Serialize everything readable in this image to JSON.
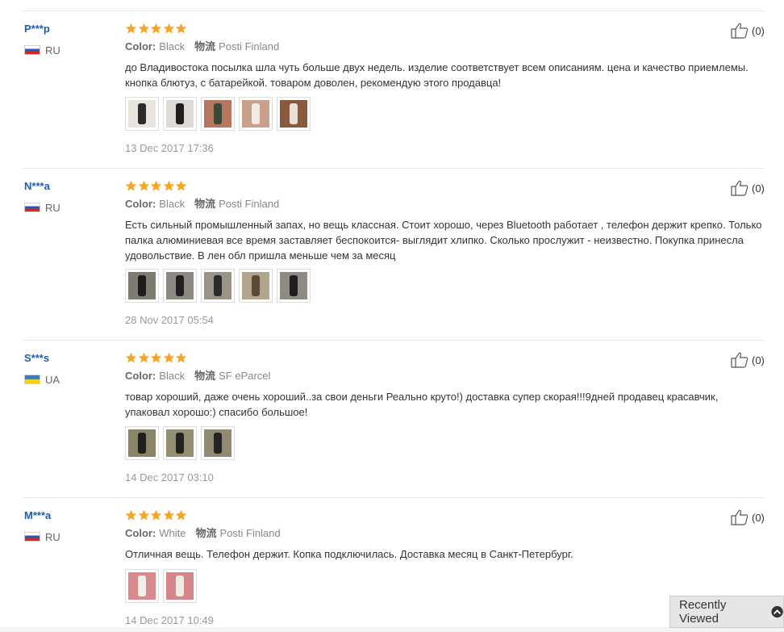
{
  "labels": {
    "color_label": "Color:",
    "shipping_label": "物流"
  },
  "reviews": [
    {
      "user": "P***p",
      "country": "RU",
      "rating": 5,
      "color": "Black",
      "shipping": "Posti Finland",
      "text": "до Владивостока посылка шла чуть больше двух недель. изделие соответствует всем описаниям. цена и качество приемлемы. кнопка блютуз, с батарейкой. товаром доволен, рекомендую этого продавца!",
      "photos": [
        {
          "bg": "#e9e4de",
          "obj": "#2a2a2a"
        },
        {
          "bg": "#dedbd6",
          "obj": "#1e1e1e"
        },
        {
          "bg": "#b7765e",
          "obj": "#3a4a3a"
        },
        {
          "bg": "#c9a08a",
          "obj": "#f1ebe6"
        },
        {
          "bg": "#8a5a3e",
          "obj": "#e8e0d8"
        }
      ],
      "date": "13 Dec 2017 17:36",
      "helpful": "(0)"
    },
    {
      "user": "N***a",
      "country": "RU",
      "rating": 5,
      "color": "Black",
      "shipping": "Posti Finland",
      "text": "Есть сильный промышленный запах, но вещь классная. Стоит хорошо, через Bluetooth работает , телефон держит крепко. Только палка алюминиевая все время заставляет беспокоится- выглядит хлипко. Сколько прослужит - неизвестно. Покупка принесла удовольствие. В лен обл пришла меньше чем за месяц",
      "photos": [
        {
          "bg": "#7d7b72",
          "obj": "#1c1c1c"
        },
        {
          "bg": "#8c8a82",
          "obj": "#202020"
        },
        {
          "bg": "#9a9488",
          "obj": "#2b2b2b"
        },
        {
          "bg": "#b3a58c",
          "obj": "#5a4a36"
        },
        {
          "bg": "#8e8b84",
          "obj": "#1e1e1e"
        }
      ],
      "date": "28 Nov 2017 05:54",
      "helpful": "(0)"
    },
    {
      "user": "S***s",
      "country": "UA",
      "rating": 5,
      "color": "Black",
      "shipping": "SF eParcel",
      "text": "товар хороший, даже очень хороший..за свои деньги Реально круто!) доставка супер скорая!!!9дней продавец красавчик, упаковал хорошо:) спасибо большое!",
      "photos": [
        {
          "bg": "#8a8468",
          "obj": "#1f1f1f"
        },
        {
          "bg": "#948e73",
          "obj": "#222222"
        },
        {
          "bg": "#8f8a70",
          "obj": "#242424"
        }
      ],
      "date": "14 Dec 2017 03:10",
      "helpful": "(0)"
    },
    {
      "user": "M***a",
      "country": "RU",
      "rating": 5,
      "color": "White",
      "shipping": "Posti Finland",
      "text": "Отличная вещь. Телефон держит. Копка подключилась. Доставка месяц в Санкт-Петербург.",
      "photos": [
        {
          "bg": "#d98a8e",
          "obj": "#f2f0ea"
        },
        {
          "bg": "#d4868a",
          "obj": "#efece6"
        }
      ],
      "date": "14 Dec 2017 10:49",
      "helpful": "(0)"
    }
  ],
  "recently_viewed": {
    "label": "Recently Viewed",
    "icon": "chevron-up-circle-icon"
  },
  "colors": {
    "star": "#f5a623",
    "username": "#1a5fb4"
  }
}
